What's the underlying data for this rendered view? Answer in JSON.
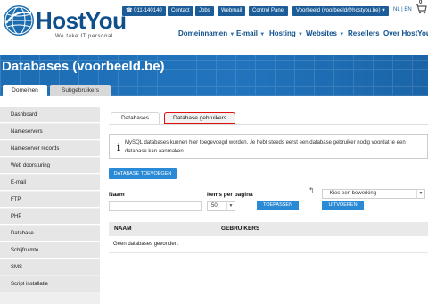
{
  "brand": {
    "name": "HostYou",
    "tagline": "We take IT personal"
  },
  "utility": {
    "phone": "011-140140",
    "links": [
      "Contact",
      "Jobs",
      "Webmail",
      "Control Panel"
    ],
    "account": "Voorbeeld (voorbeeld@hostyou.be)",
    "lang_nl": "NL",
    "lang_en": "EN",
    "cart_count": "0"
  },
  "nav": [
    {
      "label": "Domeinnamen"
    },
    {
      "label": "E-mail"
    },
    {
      "label": "Hosting"
    },
    {
      "label": "Websites"
    },
    {
      "label": "Resellers"
    },
    {
      "label": "Over HostYou"
    }
  ],
  "page": {
    "title": "Databases (voorbeeld.be)"
  },
  "top_tabs": [
    {
      "label": "Domeinen"
    },
    {
      "label": "Subgebruikers"
    }
  ],
  "sidebar": [
    {
      "label": "Dashboard"
    },
    {
      "label": "Nameservers"
    },
    {
      "label": "Nameserver records"
    },
    {
      "label": "Web doorsturing"
    },
    {
      "label": "E-mail"
    },
    {
      "label": "FTP"
    },
    {
      "label": "PHP"
    },
    {
      "label": "Database"
    },
    {
      "label": "Schijfruimte"
    },
    {
      "label": "SMS"
    },
    {
      "label": "Script installatie"
    }
  ],
  "content_tabs": [
    {
      "label": "Databases"
    },
    {
      "label": "Database gebruikers"
    }
  ],
  "info": {
    "icon": "i",
    "text": "MySQL databases kunnen hier toegevoegd worden. Je hebt steeds eerst een database gebruiker nodig voordat je een database kan aanmaken."
  },
  "add_button": "DATABASE TOEVOEGEN",
  "filter": {
    "name_label": "Naam",
    "name_value": "",
    "per_page_label": "Items per pagina",
    "per_page_value": "50",
    "apply_button": "TOEPASSEN",
    "action_select": "- Kies een bewerking -",
    "execute_button": "UITVOEREN"
  },
  "table": {
    "headers": [
      "NAAM",
      "GEBRUIKERS"
    ],
    "empty_text": "Geen databases gevonden."
  },
  "colors": {
    "brand_blue": "#1c5d99",
    "banner_blue": "#1e6ab0",
    "button_blue": "#2b8ad6",
    "highlight_red": "#dd1111"
  }
}
